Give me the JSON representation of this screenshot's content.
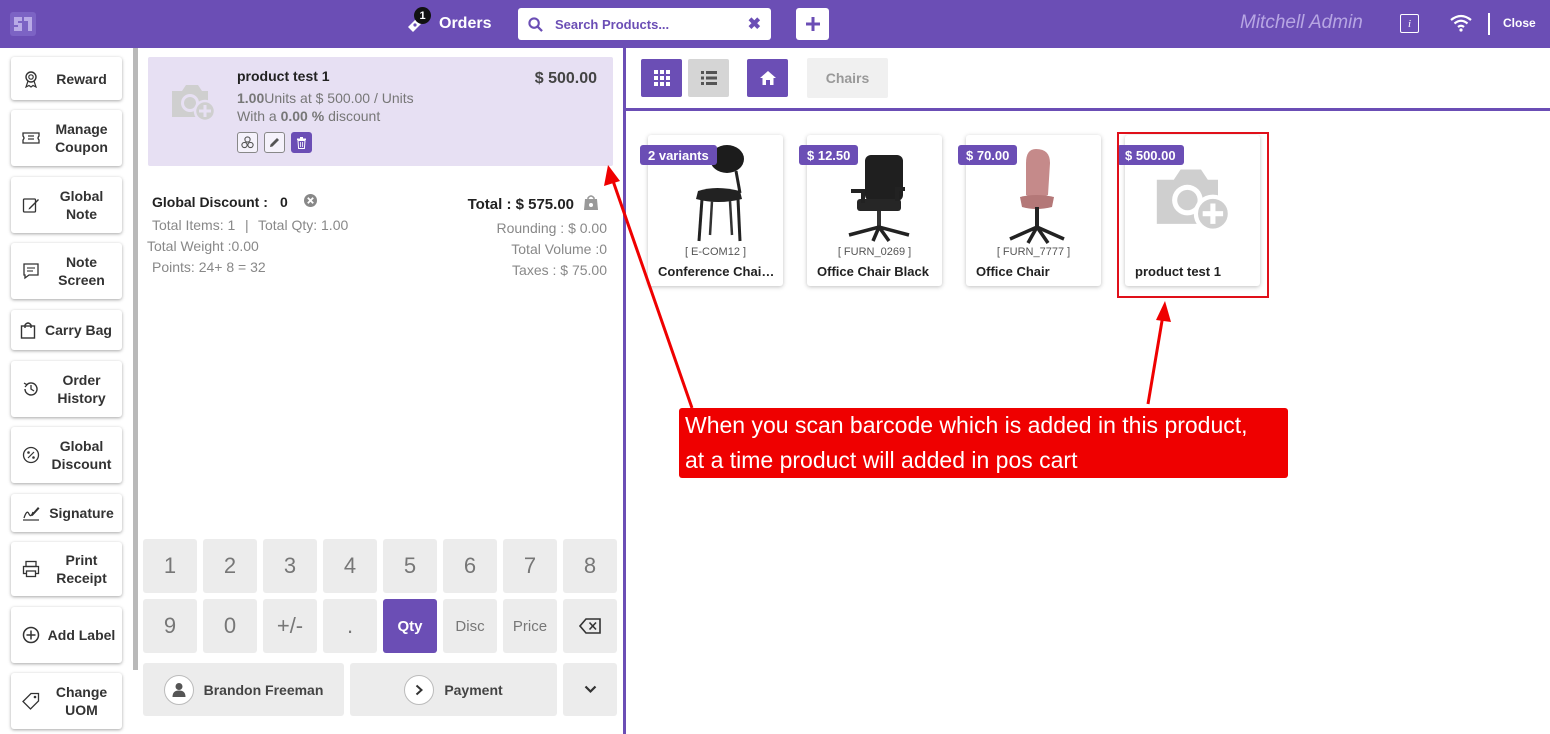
{
  "topbar": {
    "orders_label": "Orders",
    "orders_count": "1",
    "search_placeholder": "Search Products...",
    "clear_symbol": "✖",
    "add_symbol": "+",
    "user_name": "Mitchell Admin",
    "info_symbol": "i",
    "close_label": "Close",
    "bg_color": "#6b4eb5"
  },
  "actions": [
    {
      "label": "Reward",
      "icon": "award-icon"
    },
    {
      "label": "Manage Coupon",
      "icon": "ticket-icon"
    },
    {
      "label": "Global Note",
      "icon": "edit-note-icon"
    },
    {
      "label": "Note Screen",
      "icon": "note-screen-icon"
    },
    {
      "label": "Carry Bag",
      "icon": "bag-icon"
    },
    {
      "label": "Order History",
      "icon": "history-icon"
    },
    {
      "label": "Global Discount",
      "icon": "percent-icon"
    },
    {
      "label": "Signature",
      "icon": "signature-icon"
    },
    {
      "label": "Print Receipt",
      "icon": "printer-icon"
    },
    {
      "label": "Add Label",
      "icon": "plus-circle-icon"
    },
    {
      "label": "Change UOM",
      "icon": "tag-icon"
    }
  ],
  "orderline": {
    "name": "product test 1",
    "price": "$ 500.00",
    "qty": "1.00",
    "unit_text": "Units at $ 500.00 / Units",
    "discount_prefix": "With a",
    "discount_value": "0.00 %",
    "discount_suffix": "discount"
  },
  "summary": {
    "global_discount_label": "Global Discount :",
    "global_discount_value": "0",
    "total_items": "Total Items: 1",
    "separator": "|",
    "total_qty": "Total Qty: 1.00",
    "total_weight": "Total Weight :0.00",
    "points": "Points: 24+ 8 = 32",
    "total": "Total : $ 575.00",
    "rounding": "Rounding : $ 0.00",
    "total_volume": "Total Volume :0",
    "taxes": "Taxes : $ 75.00"
  },
  "numpad": {
    "row1": [
      "1",
      "2",
      "3",
      "4",
      "5",
      "6",
      "7",
      "8"
    ],
    "row2": [
      "9",
      "0",
      "+/-",
      ".",
      "Qty",
      "Disc",
      "Price",
      "⌫"
    ],
    "active": "Qty",
    "customer": "Brandon Freeman",
    "payment": "Payment"
  },
  "products": {
    "breadcrumb": "Chairs",
    "items": [
      {
        "tag": "2 variants",
        "code": "[ E-COM12 ]",
        "name": "Conference Chair (Ste..."
      },
      {
        "tag": "$ 12.50",
        "code": "[ FURN_0269 ]",
        "name": "Office Chair Black"
      },
      {
        "tag": "$ 70.00",
        "code": "[ FURN_7777 ]",
        "name": "Office Chair"
      },
      {
        "tag": "$ 500.00",
        "code": "",
        "name": "product test 1"
      }
    ]
  },
  "annotation": {
    "line1": "When you scan barcode which is added in this product,",
    "line2": "at a time product will added in pos cart",
    "color": "#ef0000"
  }
}
